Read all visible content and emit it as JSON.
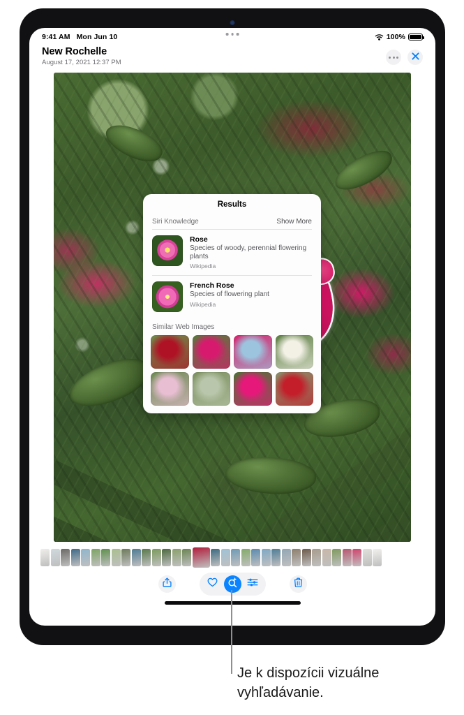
{
  "status_bar": {
    "time": "9:41 AM",
    "date": "Mon Jun 10",
    "battery_percent": "100%",
    "wifi_icon": "wifi-icon",
    "battery_icon": "battery-icon"
  },
  "header": {
    "title": "New Rochelle",
    "subtitle": "August 17, 2021  12:37 PM",
    "more_icon": "more-options-icon",
    "close_icon": "close-icon"
  },
  "results_panel": {
    "title": "Results",
    "siri_knowledge_label": "Siri Knowledge",
    "show_more_label": "Show More",
    "entries": [
      {
        "name": "Rose",
        "description": "Species of woody, perennial flowering plants",
        "source": "Wikipedia",
        "thumbnail": "pink-rose-thumbnail"
      },
      {
        "name": " French Rose",
        "description": "Species of flowering plant",
        "source": "Wikipedia",
        "thumbnail": "magenta-rose-thumbnail"
      }
    ],
    "similar_web_images_label": "Similar Web Images",
    "similar_web_images": [
      {
        "name": "red-rose-bush-image",
        "colors": [
          "#b01225",
          "#6f8a4a"
        ]
      },
      {
        "name": "magenta-rose-cluster-image",
        "colors": [
          "#d81a6e",
          "#587a3c"
        ]
      },
      {
        "name": "rose-with-sky-image",
        "colors": [
          "#9cc4de",
          "#d4276e"
        ]
      },
      {
        "name": "white-roses-image",
        "colors": [
          "#f3f1e6",
          "#5d7f44"
        ]
      },
      {
        "name": "pale-pink-roses-image",
        "colors": [
          "#e8bed2",
          "#6c8a52"
        ]
      },
      {
        "name": "rose-garden-rows-image",
        "colors": [
          "#b9c6ab",
          "#7d9160"
        ]
      },
      {
        "name": "deep-pink-rose-image",
        "colors": [
          "#e6187a",
          "#4f7336"
        ]
      },
      {
        "name": "red-rose-shrub-image",
        "colors": [
          "#c31e2a",
          "#8a8f6a"
        ]
      }
    ]
  },
  "photo": {
    "subject_name": "highlighted-rose-subject",
    "alt": "Close-up of a rose bush with pink and red roses and green leaves"
  },
  "filmstrip": {
    "thumbnail_count": 33,
    "selected_index": 15,
    "thumbnails": [
      "#efeeea",
      "#cfd9dd",
      "#6b6a66",
      "#3f6a86",
      "#8fb6cc",
      "#7da463",
      "#5f8f4c",
      "#a9bf8e",
      "#6d7a5a",
      "#4e7c93",
      "#58794a",
      "#7c9a5c",
      "#4c6a3e",
      "#8aa06c",
      "#6c8552",
      "#b01e3c",
      "#3c6a80",
      "#9fc3d6",
      "#6f9ab5",
      "#84ab6a",
      "#5a8bae",
      "#7fa8c4",
      "#4f7d96",
      "#93a7b5",
      "#8d7f6e",
      "#6e5b4a",
      "#a89c8d",
      "#c9b7a8",
      "#7f9a5e",
      "#b7576f",
      "#d0436e",
      "#e2e0dc",
      "#f2f1ee"
    ]
  },
  "toolbar": {
    "share_icon": "share-icon",
    "favorite_icon": "heart-icon",
    "visual_lookup_icon": "visual-lookup-icon",
    "adjust_icon": "adjust-sliders-icon",
    "delete_icon": "trash-icon",
    "active_button": "visual-lookup-icon",
    "accent_color": "#0a84ff",
    "pill_background": "#f2f2f4"
  },
  "callout": {
    "caption": "Je k dispozícii vizuálne vyhľadávanie.",
    "line_color": "#8e8e93"
  }
}
